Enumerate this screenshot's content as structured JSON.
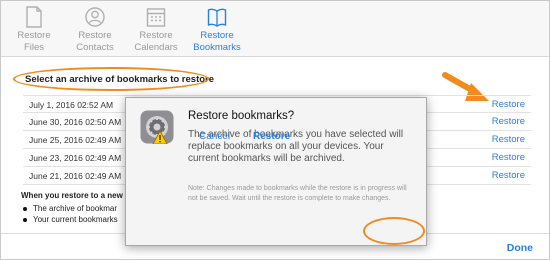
{
  "toolbar": {
    "items": [
      {
        "label_line1": "Restore",
        "label_line2": "Files",
        "icon": "file-icon"
      },
      {
        "label_line1": "Restore",
        "label_line2": "Contacts",
        "icon": "contact-icon"
      },
      {
        "label_line1": "Restore",
        "label_line2": "Calendars",
        "icon": "calendar-icon"
      },
      {
        "label_line1": "Restore",
        "label_line2": "Bookmarks",
        "icon": "book-icon"
      }
    ],
    "active_index": 3
  },
  "main": {
    "heading": "Select an archive of bookmarks to restore",
    "rows": [
      {
        "date": "July 1, 2016 02:52 AM",
        "action": "Restore"
      },
      {
        "date": "June 30, 2016 02:50 AM",
        "action": "Restore"
      },
      {
        "date": "June 25, 2016 02:49 AM",
        "action": "Restore"
      },
      {
        "date": "June 23, 2016 02:49 AM",
        "action": "Restore"
      },
      {
        "date": "June 21, 2016 02:49 AM",
        "action": "Restore"
      }
    ],
    "note": "When you restore to a new",
    "bullets": [
      "The archive of bookmar",
      "Your current bookmarks"
    ],
    "done_label": "Done"
  },
  "dialog": {
    "title": "Restore bookmarks?",
    "body": "The archive of bookmarks you have selected will replace bookmarks on all your devices. Your current bookmarks will be archived.",
    "note": "Note: Changes made to bookmarks while the restore is in progress will not be saved. Wait until the restore is complete to make changes.",
    "cancel_label": "Cancel",
    "restore_label": "Restore",
    "icon": "settings-gear-icon"
  },
  "colors": {
    "accent": "#2a7fe0",
    "highlight": "#f08c1f"
  }
}
